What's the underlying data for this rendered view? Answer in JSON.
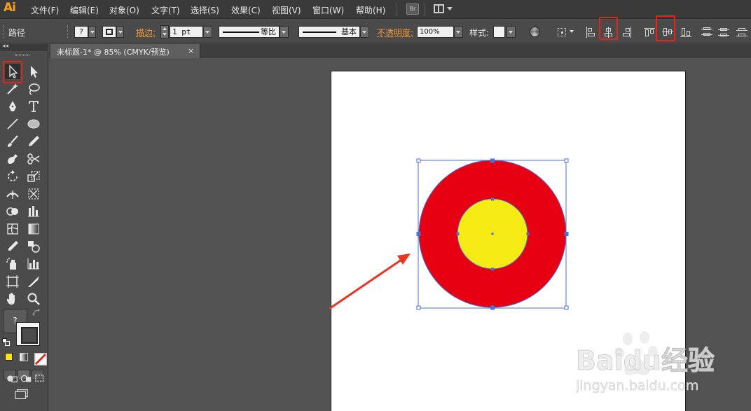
{
  "app": {
    "logo": "Ai",
    "menus": [
      "文件(F)",
      "编辑(E)",
      "对象(O)",
      "文字(T)",
      "选择(S)",
      "效果(C)",
      "视图(V)",
      "窗口(W)",
      "帮助(H)"
    ],
    "bridge_label": "Br"
  },
  "control_bar": {
    "selection_label": "路径",
    "fill_swatch": "?",
    "stroke_label": "描边:",
    "stroke_weight": "1 pt",
    "stroke_profile": "等比",
    "brush": "基本",
    "opacity_label": "不透明度:",
    "opacity_value": "100%",
    "style_label": "样式:"
  },
  "document_tab": {
    "title": "未标题-1* @ 85% (CMYK/预览)",
    "close": "×"
  },
  "tools": {
    "fill_placeholder": "?"
  },
  "colors": {
    "outer_circle": "#e60012",
    "inner_circle": "#f5ea14",
    "selection": "#4a6fd8",
    "highlight": "#e3241b",
    "accent": "#f7a01d"
  },
  "watermark": {
    "brand": "Baidu经验",
    "url": "jingyan.baidu.com"
  }
}
